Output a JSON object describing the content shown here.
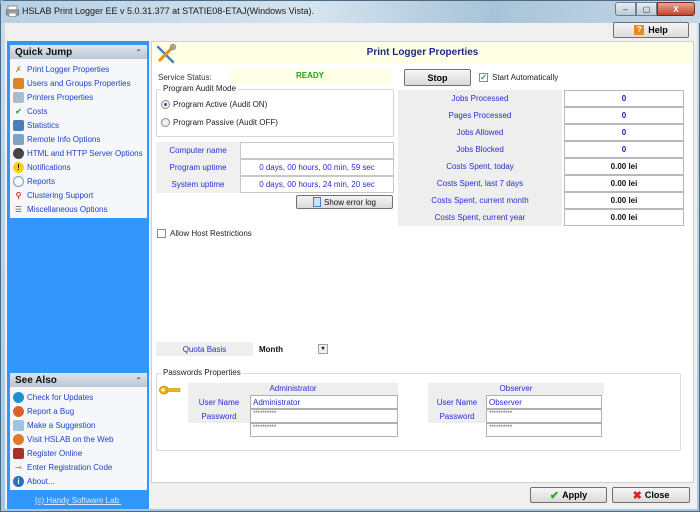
{
  "window": {
    "title": "HSLAB Print Logger EE v 5.0.31.377 at STATIE08-ETAJ(Windows Vista).",
    "minimize_label": "–",
    "maximize_label": "▢",
    "close_label": "X"
  },
  "toolbar": {
    "help_label": "Help",
    "help_icon": "?"
  },
  "sidebar": {
    "quick_jump": {
      "title": "Quick Jump",
      "collapse_icon": "⌃",
      "items": [
        {
          "label": "Print Logger Properties",
          "icon": "tools-icon"
        },
        {
          "label": "Users and Groups Properties",
          "icon": "users-icon"
        },
        {
          "label": "Printers Properties",
          "icon": "printer-icon"
        },
        {
          "label": "Costs",
          "icon": "costs-check-icon"
        },
        {
          "label": "Statistics",
          "icon": "statistics-icon"
        },
        {
          "label": "Remote Info Options",
          "icon": "remote-icon"
        },
        {
          "label": "HTML and HTTP Server Options",
          "icon": "html-icon"
        },
        {
          "label": "Notifications",
          "icon": "warning-icon"
        },
        {
          "label": "Reports",
          "icon": "reports-icon"
        },
        {
          "label": "Clustering Support",
          "icon": "clustering-icon"
        },
        {
          "label": "Miscellaneous Options",
          "icon": "misc-icon"
        }
      ]
    },
    "see_also": {
      "title": "See Also",
      "collapse_icon": "⌃",
      "items": [
        {
          "label": "Check for Updates",
          "icon": "globe-icon"
        },
        {
          "label": "Report a Bug",
          "icon": "bug-icon"
        },
        {
          "label": "Make a Suggestion",
          "icon": "suggestion-icon"
        },
        {
          "label": "Visit HSLAB on the Web",
          "icon": "web-icon"
        },
        {
          "label": "Register Online",
          "icon": "register-icon"
        },
        {
          "label": "Enter Registration Code",
          "icon": "key-code-icon"
        },
        {
          "label": "About...",
          "icon": "info-icon"
        }
      ]
    },
    "copyright": "(c) Handy Software Lab."
  },
  "main": {
    "title": "Print Logger Properties",
    "service_status_label": "Service Status:",
    "service_status_value": "READY",
    "stop_label": "Stop",
    "start_auto_label": "Start Automatically",
    "start_auto_checked": true,
    "audit_mode": {
      "legend": "Program Audit Mode",
      "options": [
        "Program Active (Audit ON)",
        "Program Passive (Audit OFF)"
      ],
      "selected": 0
    },
    "info": [
      {
        "label": "Computer name",
        "value": ""
      },
      {
        "label": "Program uptime",
        "value": "0 days, 00 hours, 00 min, 59 sec"
      },
      {
        "label": "System uptime",
        "value": "0 days, 00 hours, 24 min, 20 sec"
      }
    ],
    "show_error_log_label": "Show error log",
    "stats": [
      {
        "label": "Jobs Processed",
        "value": "0"
      },
      {
        "label": "Pages Processed",
        "value": "0"
      },
      {
        "label": "Jobs Allowed",
        "value": "0"
      },
      {
        "label": "Jobs Blocked",
        "value": "0"
      },
      {
        "label": "Costs Spent, today",
        "value": "0.00 lei"
      },
      {
        "label": "Costs Spent, last 7 days",
        "value": "0.00 lei"
      },
      {
        "label": "Costs Spent, current month",
        "value": "0.00 lei"
      },
      {
        "label": "Costs Spent, current year",
        "value": "0.00 lei"
      }
    ],
    "allow_host_restrictions_label": "Allow Host Restrictions",
    "allow_host_restrictions_checked": false,
    "quota": {
      "label": "Quota Basis",
      "value": "Month",
      "dropdown_icon": "▾"
    },
    "passwords": {
      "legend": "Passwords Properties",
      "accounts": [
        {
          "title": "Administrator",
          "user_label": "User Name",
          "user_value": "Administrator",
          "password_label": "Password",
          "password_value": "**********",
          "confirm_value": "**********"
        },
        {
          "title": "Observer",
          "user_label": "User Name",
          "user_value": "Observer",
          "password_label": "Password",
          "password_value": "**********",
          "confirm_value": "**********"
        }
      ]
    }
  },
  "footer": {
    "apply_label": "Apply",
    "close_label": "Close",
    "apply_icon": "✔",
    "close_icon": "✖"
  },
  "colors": {
    "sidebar_bg": "#3296fa",
    "link": "#1f3fd0",
    "ready": "#23a023",
    "header_bg": "#ffffe6",
    "title": "#1a2b8a"
  }
}
